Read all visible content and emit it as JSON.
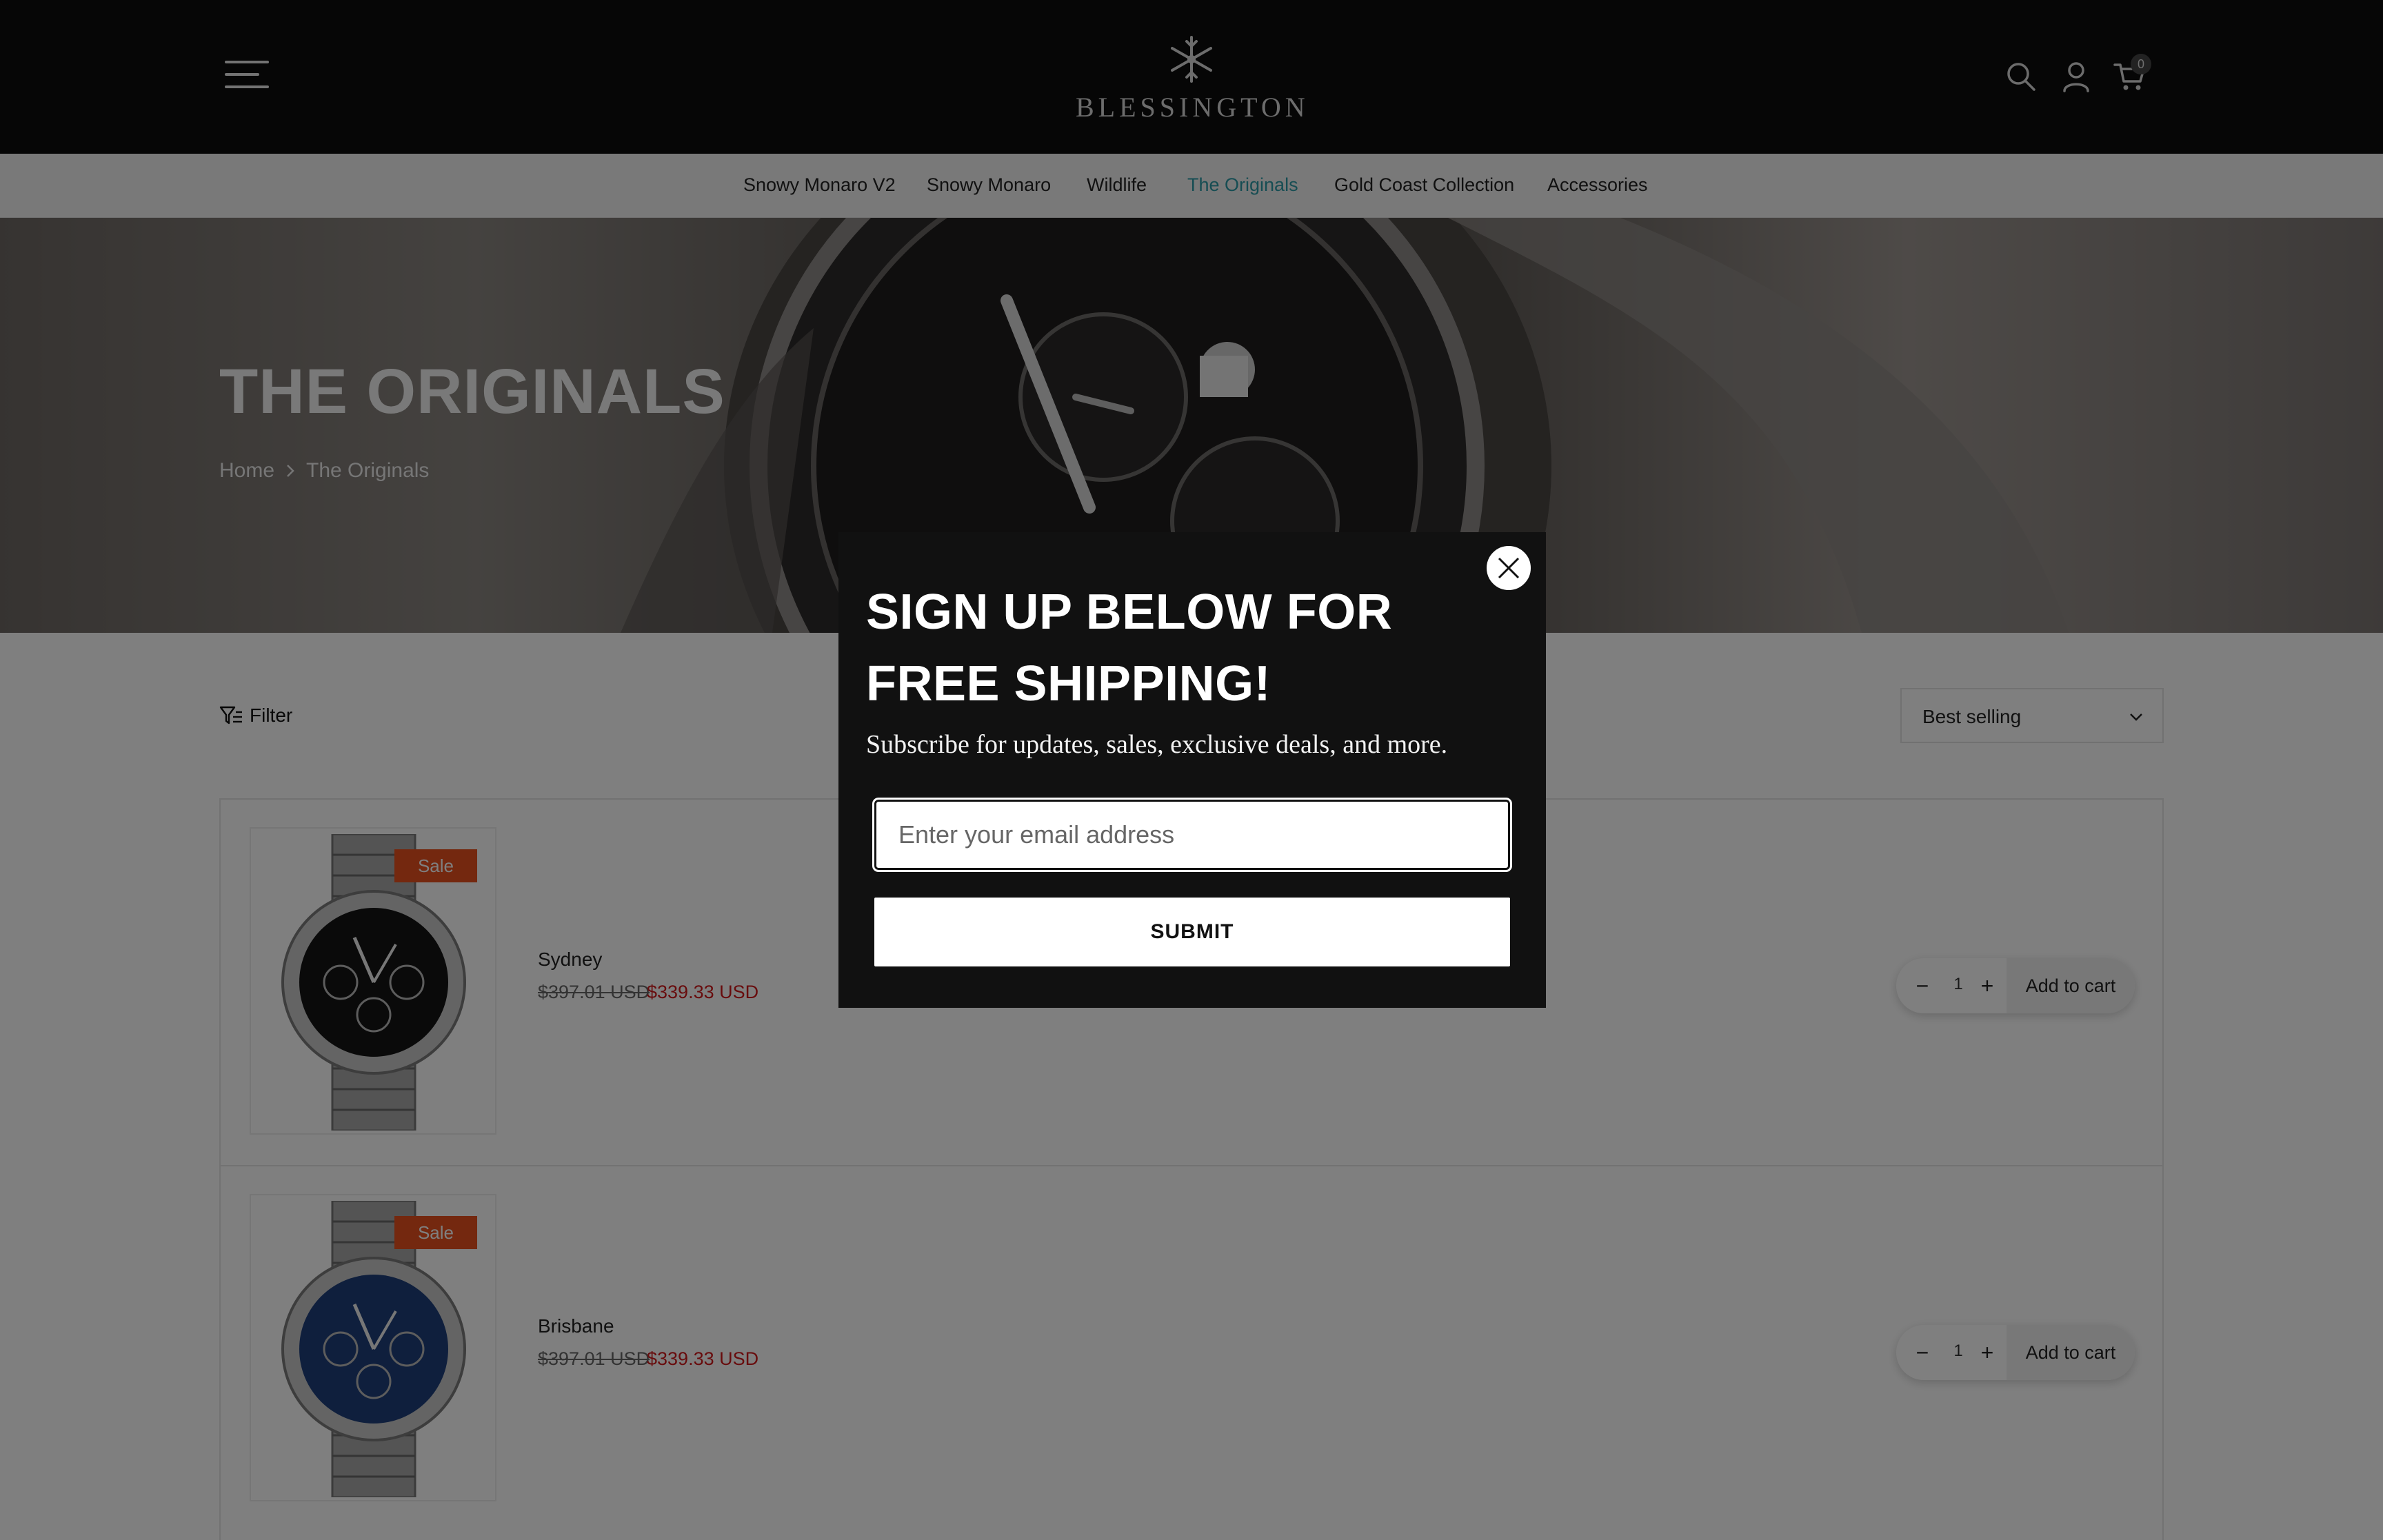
{
  "header": {
    "brand": "BLESSINGTON",
    "cart_count": "0",
    "icons": [
      "menu-icon",
      "snowflake-logo",
      "search-icon",
      "account-icon",
      "cart-icon"
    ]
  },
  "nav": {
    "items": [
      {
        "label": "Snowy Monaro V2",
        "active": false
      },
      {
        "label": "Snowy Monaro",
        "active": false
      },
      {
        "label": "Wildlife",
        "active": false
      },
      {
        "label": "The Originals",
        "active": true
      },
      {
        "label": "Gold Coast Collection",
        "active": false
      },
      {
        "label": "Accessories",
        "active": false
      }
    ]
  },
  "hero": {
    "title": "THE ORIGINALS",
    "breadcrumb": {
      "home": "Home",
      "current": "The Originals"
    }
  },
  "toolbar": {
    "filter_label": "Filter",
    "sort_selected": "Best selling"
  },
  "products": [
    {
      "name": "Sydney",
      "badge": "Sale",
      "price_old": "$397.01 USD",
      "price_new": "$339.33 USD",
      "qty": "1",
      "add_label": "Add to cart",
      "dial_color": "#141414"
    },
    {
      "name": "Brisbane",
      "badge": "Sale",
      "price_old": "$397.01 USD",
      "price_new": "$339.33 USD",
      "qty": "1",
      "add_label": "Add to cart",
      "dial_color": "#1f3f7a"
    }
  ],
  "modal": {
    "title": "SIGN UP BELOW FOR FREE SHIPPING!",
    "subtitle": "Subscribe for updates, sales, exclusive deals, and more.",
    "email_placeholder": "Enter your email address",
    "submit_label": "SUBMIT"
  },
  "colors": {
    "header_bg": "#0d0d0d",
    "nav_active": "#2c9aa6",
    "sale_badge": "#e8501f",
    "sale_price": "#d0181b"
  }
}
